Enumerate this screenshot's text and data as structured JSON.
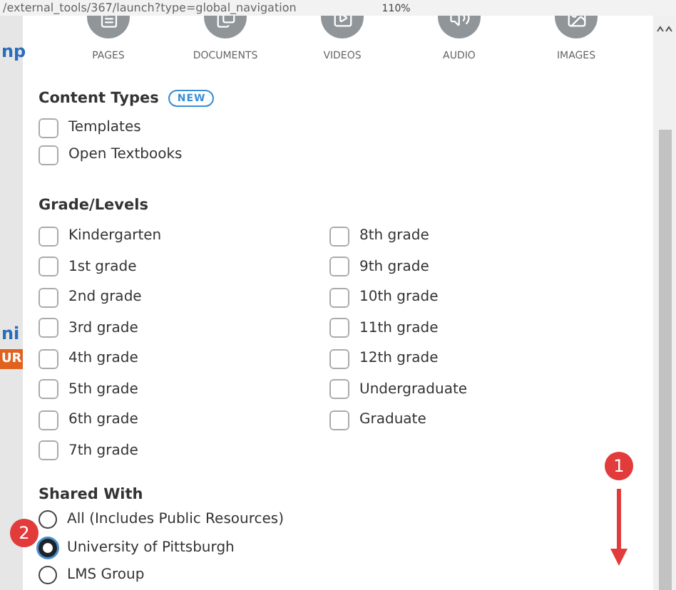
{
  "browser_bar": {
    "url": "/external_tools/367/launch?type=global_navigation",
    "zoom": "110%"
  },
  "background_page": {
    "fragments": [
      {
        "text": "np",
        "kind": "link"
      },
      {
        "text": "ni",
        "kind": "link"
      },
      {
        "text": "UR",
        "kind": "banner"
      }
    ]
  },
  "media_types": [
    {
      "label": "PAGES",
      "kind": "pages"
    },
    {
      "label": "DOCUMENTS",
      "kind": "documents"
    },
    {
      "label": "VIDEOS",
      "kind": "videos"
    },
    {
      "label": "AUDIO",
      "kind": "audio"
    },
    {
      "label": "IMAGES",
      "kind": "images"
    }
  ],
  "content_types": {
    "title": "Content Types",
    "badge": "NEW",
    "items": [
      {
        "label": "Templates",
        "checked": false
      },
      {
        "label": "Open Textbooks",
        "checked": false
      }
    ]
  },
  "grade_levels": {
    "title": "Grade/Levels",
    "items": [
      {
        "label": "Kindergarten",
        "checked": false
      },
      {
        "label": "1st grade",
        "checked": false
      },
      {
        "label": "2nd grade",
        "checked": false
      },
      {
        "label": "3rd grade",
        "checked": false
      },
      {
        "label": "4th grade",
        "checked": false
      },
      {
        "label": "5th grade",
        "checked": false
      },
      {
        "label": "6th grade",
        "checked": false
      },
      {
        "label": "7th grade",
        "checked": false
      },
      {
        "label": "8th grade",
        "checked": false
      },
      {
        "label": "9th grade",
        "checked": false
      },
      {
        "label": "10th grade",
        "checked": false
      },
      {
        "label": "11th grade",
        "checked": false
      },
      {
        "label": "12th grade",
        "checked": false
      },
      {
        "label": "Undergraduate",
        "checked": false
      },
      {
        "label": "Graduate",
        "checked": false
      }
    ]
  },
  "shared_with": {
    "title": "Shared With",
    "options": [
      {
        "label": "All (Includes Public Resources)",
        "selected": false
      },
      {
        "label": "University of Pittsburgh",
        "selected": true
      },
      {
        "label": "LMS Group",
        "selected": false
      }
    ]
  },
  "annotations": [
    {
      "label": "1",
      "kind": "arrow"
    },
    {
      "label": "2",
      "kind": "marker"
    }
  ]
}
